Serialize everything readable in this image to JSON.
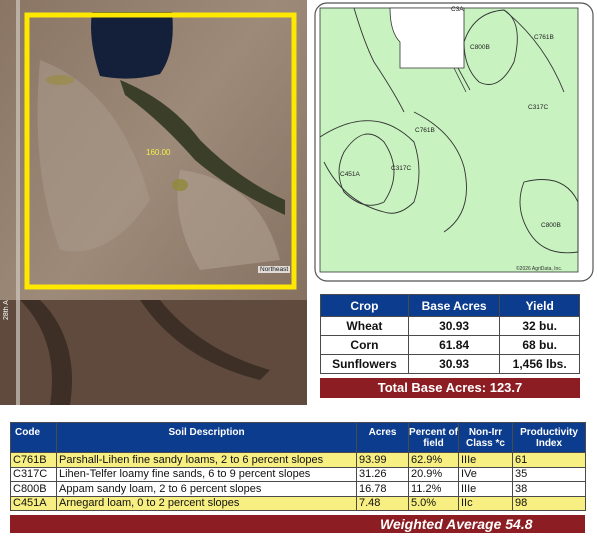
{
  "aerial": {
    "acres_label": "160.00",
    "north_label": "Northeast",
    "road_label": "28th A"
  },
  "soil_map": {
    "labels": [
      "C3A",
      "C800B",
      "C761B",
      "C317C",
      "C761B",
      "C451A",
      "C317C",
      "C800B"
    ],
    "copyright": "©2026 AgriData, Inc."
  },
  "crop_table": {
    "headers": [
      "Crop",
      "Base Acres",
      "Yield"
    ],
    "rows": [
      [
        "Wheat",
        "30.93",
        "32 bu."
      ],
      [
        "Corn",
        "61.84",
        "68 bu."
      ],
      [
        "Sunflowers",
        "30.93",
        "1,456 lbs."
      ]
    ],
    "total_label": "Total Base Acres:",
    "total_value": "123.7"
  },
  "soil_table": {
    "headers": [
      "Code",
      "Soil Description",
      "Acres",
      "Percent of field",
      "Non-Irr Class *c",
      "Productivity Index"
    ],
    "rows": [
      [
        "C761B",
        "Parshall-Lihen fine sandy loams, 2 to 6 percent slopes",
        "93.99",
        "62.9%",
        "IIIe",
        "61"
      ],
      [
        "C317C",
        "Lihen-Telfer loamy fine sands, 6 to 9 percent slopes",
        "31.26",
        "20.9%",
        "IVe",
        "35"
      ],
      [
        "C800B",
        "Appam sandy loam, 2 to 6 percent slopes",
        "16.78",
        "11.2%",
        "IIIe",
        "38"
      ],
      [
        "C451A",
        "Arnegard loam, 0 to 2 percent slopes",
        "7.48",
        "5.0%",
        "IIc",
        "98"
      ]
    ],
    "highlight_rows": [
      0,
      3
    ],
    "weighted_label": "Weighted Average",
    "weighted_value": "54.8"
  },
  "colors": {
    "header_blue": "#0b3c8e",
    "total_red": "#8c1d22",
    "highlight_yellow": "#f7ef82",
    "boundary_yellow": "#ffe800",
    "soil_green": "#c8f2c0"
  }
}
